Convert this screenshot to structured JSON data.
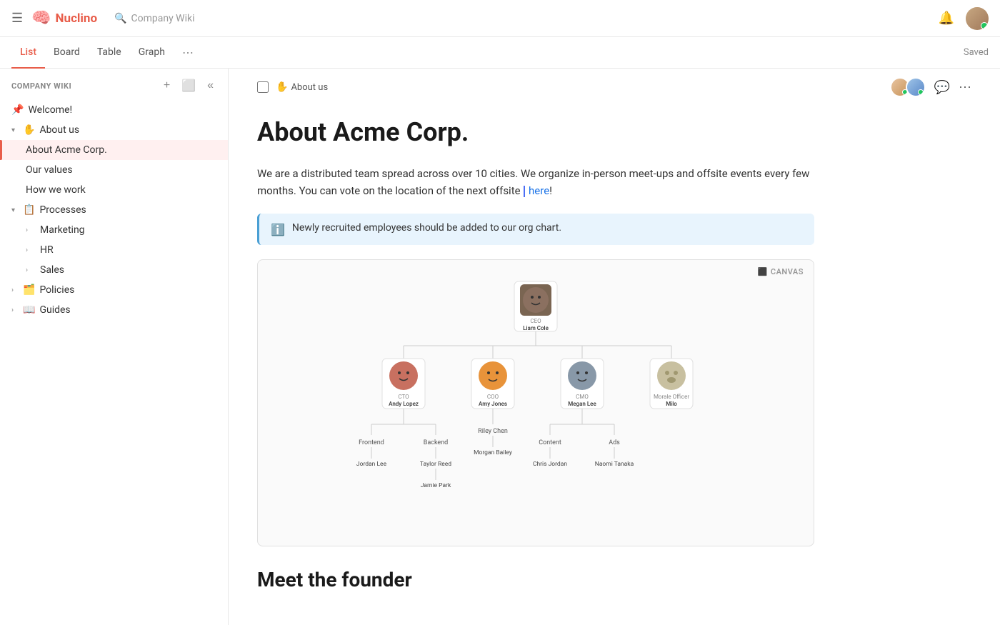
{
  "app": {
    "name": "Nuclino",
    "search_placeholder": "Company Wiki"
  },
  "top_nav": {
    "saved_label": "Saved"
  },
  "tabs": [
    {
      "id": "list",
      "label": "List",
      "active": true
    },
    {
      "id": "board",
      "label": "Board",
      "active": false
    },
    {
      "id": "table",
      "label": "Table",
      "active": false
    },
    {
      "id": "graph",
      "label": "Graph",
      "active": false
    }
  ],
  "sidebar": {
    "workspace_title": "COMPANY WIKI",
    "items": [
      {
        "id": "welcome",
        "label": "Welcome!",
        "icon": "📌",
        "indent": 0,
        "pinned": true
      },
      {
        "id": "about-us",
        "label": "About us",
        "icon": "✋",
        "indent": 0,
        "expanded": true
      },
      {
        "id": "about-acme",
        "label": "About Acme Corp.",
        "indent": 1,
        "active": true
      },
      {
        "id": "our-values",
        "label": "Our values",
        "indent": 1
      },
      {
        "id": "how-we-work",
        "label": "How we work",
        "indent": 1
      },
      {
        "id": "processes",
        "label": "Processes",
        "icon": "📋",
        "indent": 0,
        "expanded": true
      },
      {
        "id": "marketing",
        "label": "Marketing",
        "indent": 1,
        "hasChildren": true
      },
      {
        "id": "hr",
        "label": "HR",
        "indent": 1,
        "hasChildren": true
      },
      {
        "id": "sales",
        "label": "Sales",
        "indent": 1,
        "hasChildren": true
      },
      {
        "id": "policies",
        "label": "Policies",
        "icon": "🗂️",
        "indent": 0
      },
      {
        "id": "guides",
        "label": "Guides",
        "icon": "📖",
        "indent": 0
      }
    ]
  },
  "page": {
    "breadcrumb_emoji": "✋",
    "breadcrumb_text": "About us",
    "title": "About Acme Corp.",
    "paragraph": "We are a distributed team spread across over 10 cities. We organize in-person meet-ups and offsite events every few months. You can vote on the location of the next offsite ",
    "link_text": "here",
    "link_suffix": "!",
    "info_message": "Newly recruited employees should be added to our org chart.",
    "canvas_label": "CANVAS",
    "section2_title": "Meet the founder"
  },
  "org_chart": {
    "ceo": {
      "role": "CEO",
      "name": "Liam Cole"
    },
    "level2": [
      {
        "role": "CTO",
        "name": "Andy Lopez",
        "avatar_class": "cto-avatar"
      },
      {
        "role": "COO",
        "name": "Amy Jones",
        "avatar_class": "coo-avatar"
      },
      {
        "role": "CMO",
        "name": "Megan Lee",
        "avatar_class": "cmo-avatar"
      },
      {
        "role": "Morale Officer",
        "name": "Milo",
        "avatar_class": "morale-avatar"
      }
    ],
    "cto_reports": [
      {
        "name": "Frontend"
      },
      {
        "name": "Backend"
      }
    ],
    "coo_reports": [
      {
        "name": "Riley Chen"
      }
    ],
    "cmo_reports": [
      {
        "name": "Content"
      },
      {
        "name": "Ads"
      }
    ],
    "leaf_nodes": {
      "frontend": "Jordan Lee",
      "backend": "Taylor Reed",
      "backend2": "Jamie Park",
      "riley": "Morgan Bailey",
      "content": "Chris Jordan",
      "ads": "Naomi Tanaka"
    }
  }
}
